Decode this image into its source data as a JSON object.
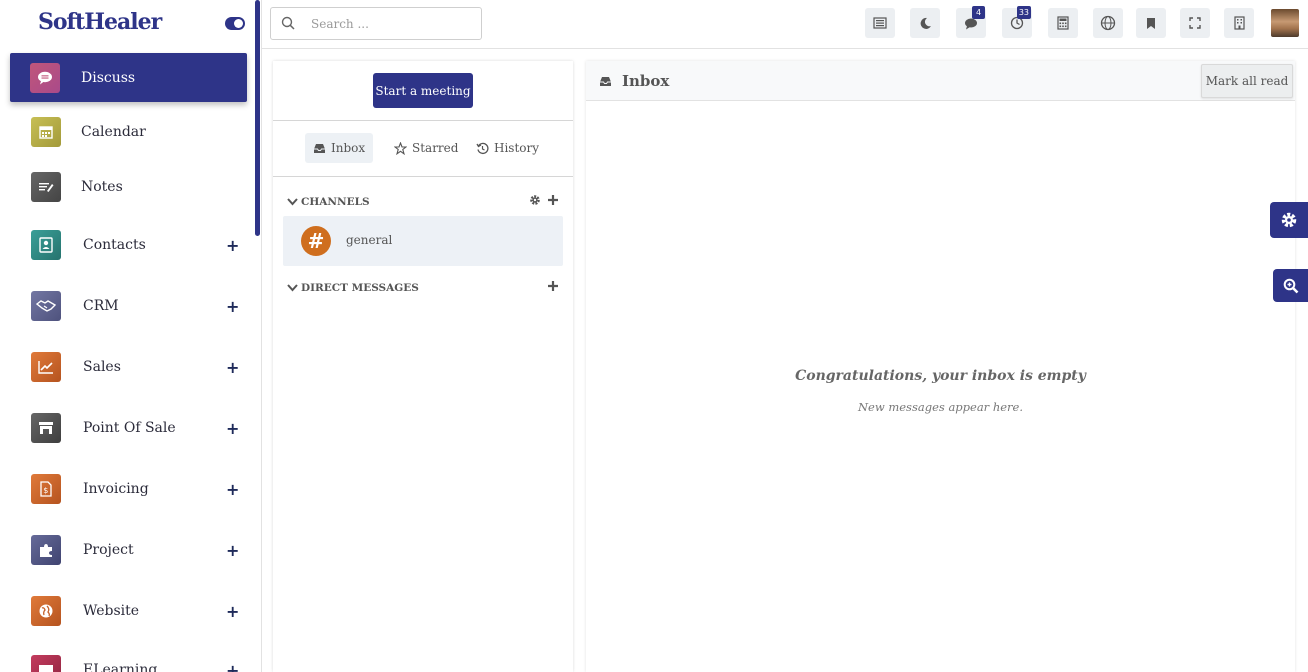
{
  "app": {
    "logo": "SoftHealer"
  },
  "sidebar": {
    "items": [
      {
        "label": "Discuss",
        "icon": "chat-icon",
        "color": "#c0567a",
        "has_plus": false
      },
      {
        "label": "Calendar",
        "icon": "calendar-icon",
        "color": "#b7b046",
        "has_plus": false
      },
      {
        "label": "Notes",
        "icon": "notes-icon",
        "color": "#555555",
        "has_plus": false
      },
      {
        "label": "Contacts",
        "icon": "contact-card-icon",
        "color": "#2f8f89",
        "has_plus": true
      },
      {
        "label": "CRM",
        "icon": "handshake-icon",
        "color": "#6a6e99",
        "has_plus": true
      },
      {
        "label": "Sales",
        "icon": "chart-line-icon",
        "color": "#d56e32",
        "has_plus": true
      },
      {
        "label": "Point Of Sale",
        "icon": "store-icon",
        "color": "#555555",
        "has_plus": true
      },
      {
        "label": "Invoicing",
        "icon": "invoice-icon",
        "color": "#d9712f",
        "has_plus": true
      },
      {
        "label": "Project",
        "icon": "puzzle-icon",
        "color": "#5a5f8a",
        "has_plus": true
      },
      {
        "label": "Website",
        "icon": "globe-icon",
        "color": "#d56e32",
        "has_plus": true
      },
      {
        "label": "ELearning",
        "icon": "elearning-icon",
        "color": "#b53352",
        "has_plus": true
      }
    ],
    "plus_glyph": "+"
  },
  "topbar": {
    "search_placeholder": "Search ...",
    "buttons": [
      {
        "icon": "list-icon"
      },
      {
        "icon": "moon-icon"
      },
      {
        "icon": "messages-icon",
        "badge": "4"
      },
      {
        "icon": "activity-icon",
        "badge": "33"
      },
      {
        "icon": "calculator-icon"
      },
      {
        "icon": "language-globe-icon"
      },
      {
        "icon": "bookmark-icon"
      },
      {
        "icon": "fullscreen-icon"
      },
      {
        "icon": "building-icon"
      }
    ]
  },
  "discuss": {
    "start_meeting": "Start a meeting",
    "mailboxes": [
      {
        "label": "Inbox",
        "icon": "inbox-icon",
        "active": true
      },
      {
        "label": "Starred",
        "icon": "star-icon",
        "active": false
      },
      {
        "label": "History",
        "icon": "history-icon",
        "active": false
      }
    ],
    "channels_title": "CHANNELS",
    "channels": [
      {
        "name": "general",
        "glyph": "#"
      }
    ],
    "direct_messages_title": "DIRECT MESSAGES"
  },
  "thread": {
    "title": "Inbox",
    "mark_all_read": "Mark all read",
    "empty_title": "Congratulations, your inbox is empty",
    "empty_subtitle": "New messages appear here."
  },
  "colors": {
    "brand": "#2e3488",
    "channel_avatar": "#cf6e1e"
  }
}
